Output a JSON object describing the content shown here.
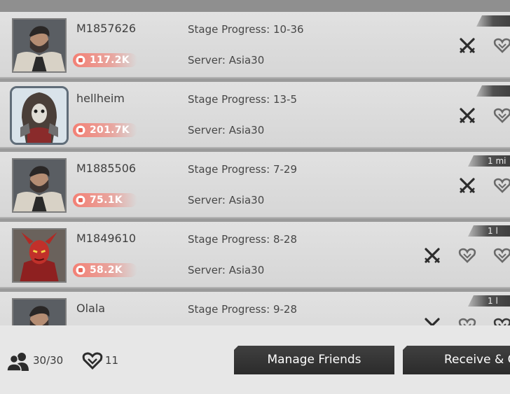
{
  "friends": [
    {
      "name": "M1857626",
      "power": "117.2K",
      "stage": "Stage Progress: 10-36",
      "server": "Server: Asia30",
      "last_online": "",
      "avatar": "bearded-man-fur-coat",
      "framed": false
    },
    {
      "name": "hellheim",
      "power": "201.7K",
      "stage": "Stage Progress: 13-5",
      "server": "Server: Asia30",
      "last_online": "",
      "avatar": "hooded-skull-warrior",
      "framed": true
    },
    {
      "name": "M1885506",
      "power": "75.1K",
      "stage": "Stage Progress: 7-29",
      "server": "Server: Asia30",
      "last_online": "1 mi",
      "avatar": "bearded-man-fur-coat",
      "framed": false
    },
    {
      "name": "M1849610",
      "power": "58.2K",
      "stage": "Stage Progress: 8-28",
      "server": "Server: Asia30",
      "last_online": "1 l",
      "avatar": "red-horned-demon",
      "framed": false
    },
    {
      "name": "Olala",
      "power": "",
      "stage": "Stage Progress: 9-28",
      "server": "",
      "last_online": "1 l",
      "avatar": "bearded-man-fur-coat",
      "framed": false
    }
  ],
  "footer": {
    "friends_count": "30/30",
    "hearts_count": "11",
    "manage_label": "Manage Friends",
    "receive_label": "Receive & G"
  },
  "colors": {
    "power_badge": "#f47b6f",
    "row_bg": "#dcdcdc",
    "button_bg": "#333333",
    "footer_bg": "#e7e7e7"
  },
  "icons": [
    "fist-icon",
    "crossed-swords-icon",
    "heart-icon",
    "friends-icon",
    "hearts-icon"
  ]
}
